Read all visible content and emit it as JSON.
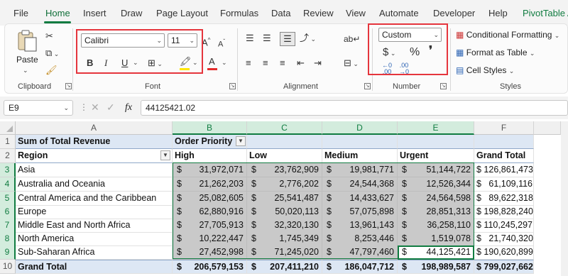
{
  "menu": [
    "File",
    "Home",
    "Insert",
    "Draw",
    "Page Layout",
    "Formulas",
    "Data",
    "Review",
    "View",
    "Automate",
    "Developer",
    "Help",
    "PivotTable A"
  ],
  "ribbon": {
    "clipboard": {
      "paste_label": "Paste",
      "group_label": "Clipboard"
    },
    "font": {
      "font_name": "Calibri",
      "font_size": "11",
      "group_label": "Font",
      "bold": "B",
      "italic": "I",
      "underline": "U"
    },
    "alignment": {
      "group_label": "Alignment"
    },
    "number": {
      "format": "Custom",
      "currency": "$",
      "percent": "%",
      "comma": "❜",
      "group_label": "Number"
    },
    "styles": {
      "conditional_formatting": "Conditional Formatting",
      "format_as_table": "Format as Table",
      "cell_styles": "Cell Styles",
      "group_label": "Styles"
    }
  },
  "formula_bar": {
    "name_box": "E9",
    "fx": "fx",
    "value": "44125421.02"
  },
  "columns": [
    "A",
    "B",
    "C",
    "D",
    "E",
    "F"
  ],
  "rows": [
    "1",
    "2",
    "3",
    "4",
    "5",
    "6",
    "7",
    "8",
    "9",
    "10"
  ],
  "pivot": {
    "title": "Sum of Total Revenue",
    "col_field": "Order Priority",
    "row_field": "Region",
    "headers": [
      "High",
      "Low",
      "Medium",
      "Urgent",
      "Grand Total"
    ],
    "data": [
      {
        "region": "Asia",
        "values": [
          "31,972,071",
          "23,762,909",
          "19,981,771",
          "51,144,722"
        ],
        "total": "$ 126,861,473"
      },
      {
        "region": "Australia and Oceania",
        "values": [
          "21,262,203",
          "2,776,202",
          "24,544,368",
          "12,526,344"
        ],
        "total": "$   61,109,116"
      },
      {
        "region": "Central America and the Caribbean",
        "values": [
          "25,082,605",
          "25,541,487",
          "14,433,627",
          "24,564,598"
        ],
        "total": "$   89,622,318"
      },
      {
        "region": "Europe",
        "values": [
          "62,880,916",
          "50,020,113",
          "57,075,898",
          "28,851,313"
        ],
        "total": "$ 198,828,240"
      },
      {
        "region": "Middle East and North Africa",
        "values": [
          "27,705,913",
          "32,320,130",
          "13,961,143",
          "36,258,110"
        ],
        "total": "$ 110,245,297"
      },
      {
        "region": "North America",
        "values": [
          "10,222,447",
          "1,745,349",
          "8,253,446",
          "1,519,078"
        ],
        "total": "$   21,740,320"
      },
      {
        "region": "Sub-Saharan Africa",
        "values": [
          "27,452,998",
          "71,245,020",
          "47,797,460",
          "44,125,421"
        ],
        "total": "$ 190,620,899"
      }
    ],
    "grand_total": {
      "label": "Grand Total",
      "values": [
        "206,579,153",
        "207,411,210",
        "186,047,712",
        "198,989,587"
      ],
      "total": "$ 799,027,662"
    },
    "currency_symbol": "$"
  },
  "colors": {
    "accent": "#107c41",
    "highlight_box": "#e5353d",
    "selection_fill": "#c9c9c9"
  }
}
